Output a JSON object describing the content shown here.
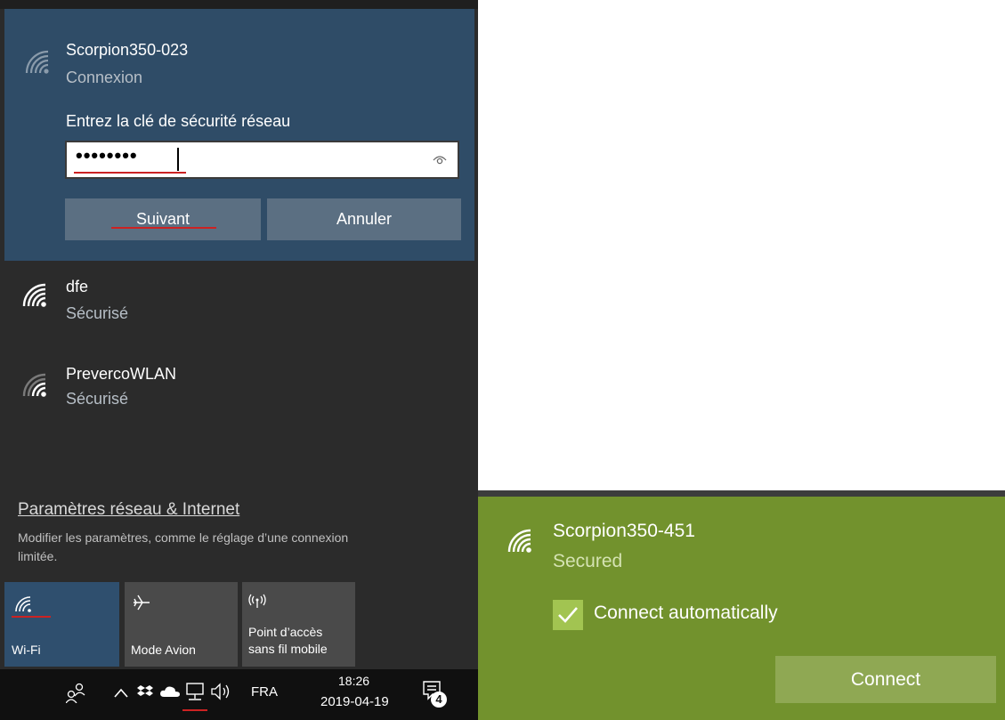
{
  "selected_network": {
    "name": "Scorpion350-023",
    "status": "Connexion",
    "security_prompt": "Entrez la clé de sécurité réseau",
    "password_masked": "••••••••",
    "next_label": "Suivant",
    "cancel_label": "Annuler"
  },
  "networks": [
    {
      "name": "dfe",
      "status": "Sécurisé"
    },
    {
      "name": "PrevercoWLAN",
      "status": "Sécurisé"
    }
  ],
  "settings": {
    "link": "Paramètres réseau & Internet",
    "description_line1": "Modifier les paramètres, comme le réglage d’une connexion",
    "description_line2": "limitée."
  },
  "quick_actions": {
    "wifi": "Wi-Fi",
    "airplane": "Mode Avion",
    "hotspot_line1": "Point d’accès",
    "hotspot_line2": "sans fil mobile"
  },
  "taskbar": {
    "language": "FRA",
    "time": "18:26",
    "date": "2019-04-19",
    "notification_count": "4"
  },
  "green_panel": {
    "network_name": "Scorpion350-451",
    "status": "Secured",
    "auto_connect_label": "Connect automatically",
    "auto_connect_checked": true,
    "connect_label": "Connect"
  },
  "colors": {
    "flyout_bg": "#2b2b2b",
    "selected_bg": "#2f4c67",
    "button_bg": "#5b6f82",
    "green_panel_bg": "#72922d",
    "underline_red": "#cc2222"
  }
}
